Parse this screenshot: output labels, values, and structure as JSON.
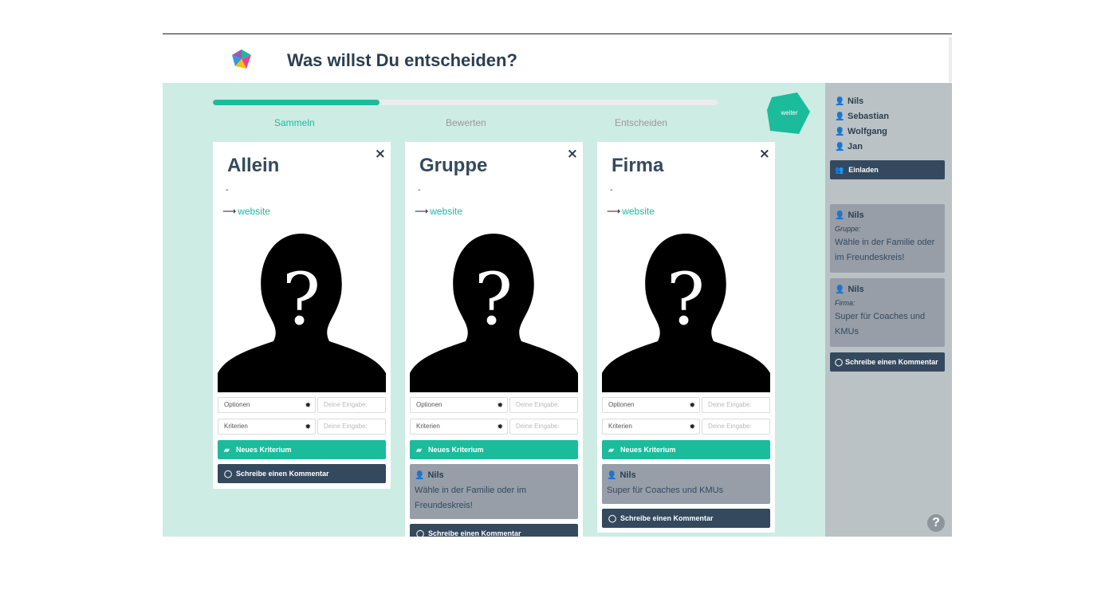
{
  "header": {
    "title": "Was willst Du entscheiden?"
  },
  "progress": {
    "fraction": 0.33,
    "steps": [
      "Sammeln",
      "Bewerten",
      "Entscheiden"
    ],
    "active_step": 0,
    "next_label": "weiter"
  },
  "card_labels": {
    "options": "Optionen",
    "criteria": "Kriterien",
    "input_placeholder": "Deine Eingabe:",
    "new_criterion": "Neues Kriterium",
    "write_comment": "Schreibe einen Kommentar",
    "link": "website",
    "dash": "-",
    "close": "×"
  },
  "cards": [
    {
      "name": "Allein",
      "comments": []
    },
    {
      "name": "Gruppe",
      "comments": [
        {
          "author": "Nils",
          "text": "Wähle in der Familie oder im Freundeskreis!"
        }
      ]
    },
    {
      "name": "Firma",
      "comments": [
        {
          "author": "Nils",
          "text": "Super für Coaches und KMUs"
        }
      ]
    }
  ],
  "sidebar": {
    "members": [
      {
        "name": "Nils",
        "online": true
      },
      {
        "name": "Sebastian",
        "online": false
      },
      {
        "name": "Wolfgang",
        "online": false
      },
      {
        "name": "Jan",
        "online": false
      }
    ],
    "invite_label": "Einladen",
    "comments": [
      {
        "author": "Nils",
        "ref": "Gruppe:",
        "text": "Wähle in der Familie oder im Freundeskreis!"
      },
      {
        "author": "Nils",
        "ref": "Firma:",
        "text": "Super für Coaches und KMUs"
      }
    ],
    "write_comment": "Schreibe einen Kommentar",
    "help": "?"
  },
  "colors": {
    "accent": "#1abc9c",
    "dark": "#34495e",
    "main_bg": "#cdece4",
    "side_bg": "#bac2c6",
    "comment_bg": "#979ea8"
  },
  "icons": [
    "logo-icon",
    "close-icon",
    "arrow-right-icon",
    "gear-icon",
    "tag-icon",
    "comment-icon",
    "user-icon",
    "users-icon",
    "help-icon"
  ]
}
